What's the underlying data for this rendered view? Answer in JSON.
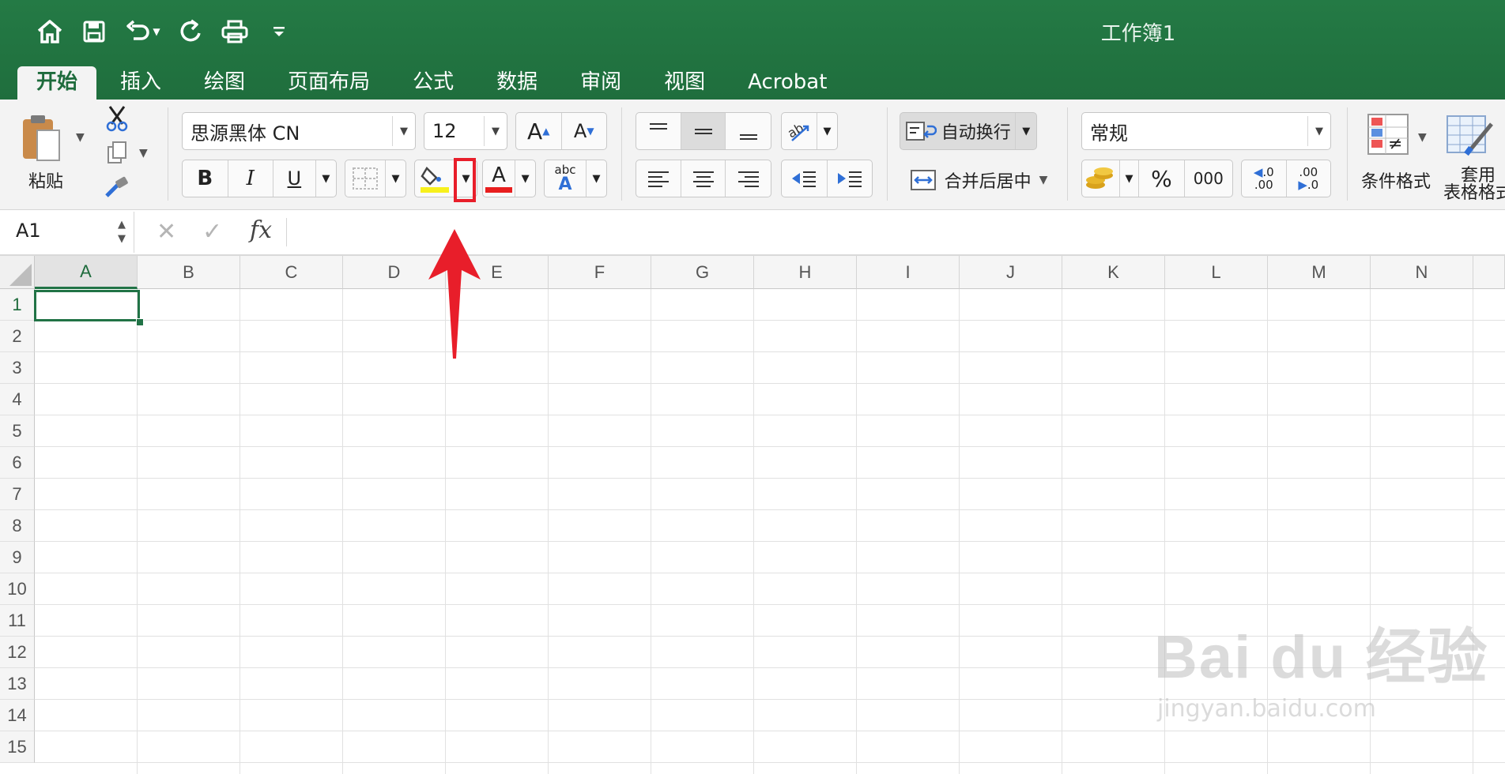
{
  "window": {
    "title": "工作簿1"
  },
  "tabs": [
    {
      "label": "开始",
      "active": true
    },
    {
      "label": "插入"
    },
    {
      "label": "绘图"
    },
    {
      "label": "页面布局"
    },
    {
      "label": "公式"
    },
    {
      "label": "数据"
    },
    {
      "label": "审阅"
    },
    {
      "label": "视图"
    },
    {
      "label": "Acrobat"
    }
  ],
  "ribbon": {
    "paste_label": "粘贴",
    "font_name": "思源黑体 CN",
    "font_size": "12",
    "bold": "B",
    "italic": "I",
    "underline": "U",
    "grow_font": "A",
    "shrink_font": "A",
    "font_color_glyph": "A",
    "phonetic_top": "abc",
    "phonetic_bottom": "A",
    "wrap_text": "自动换行",
    "merge_center": "合并后居中",
    "number_format": "常规",
    "percent": "%",
    "comma": "000",
    "inc_decimal_a": ".0",
    "inc_decimal_b": ".00",
    "dec_decimal_a": ".00",
    "dec_decimal_b": ".0",
    "conditional_format": "条件格式",
    "table_format_1": "套用",
    "table_format_2": "表格格式",
    "colors": {
      "fill_yellow": "#f7f01c",
      "font_red": "#e81e1e",
      "accent": "#217346"
    }
  },
  "formula_bar": {
    "name_box": "A1",
    "fx": "fx",
    "content": ""
  },
  "sheet": {
    "columns": [
      "A",
      "B",
      "C",
      "D",
      "E",
      "F",
      "G",
      "H",
      "I",
      "J",
      "K",
      "L",
      "M",
      "N"
    ],
    "rows": [
      "1",
      "2",
      "3",
      "4",
      "5",
      "6",
      "7",
      "8",
      "9",
      "10",
      "11",
      "12",
      "13",
      "14",
      "15"
    ],
    "active_cell": "A1"
  },
  "watermark": {
    "brand": "Bai  du 经验",
    "url": "jingyan.baidu.com"
  }
}
